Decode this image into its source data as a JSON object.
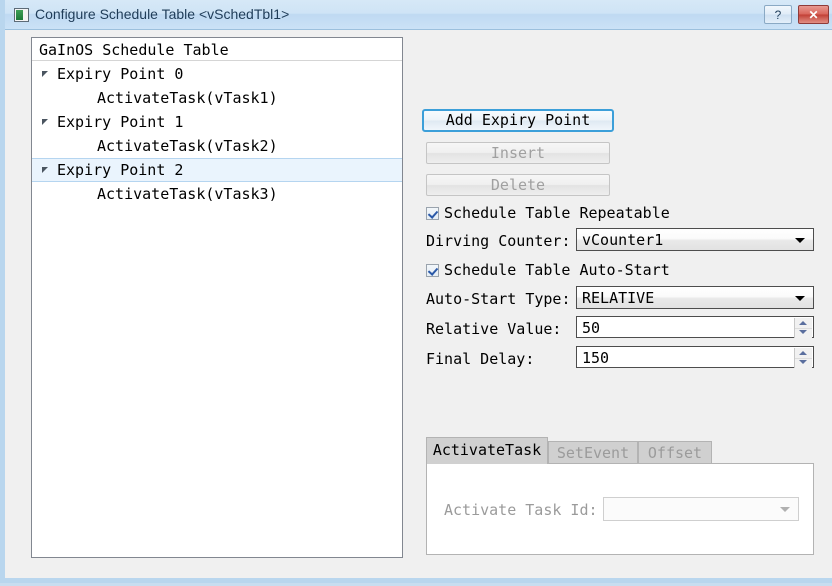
{
  "window": {
    "title": "Configure Schedule Table <vSchedTbl1>",
    "help_label": "?",
    "close_label": "✕"
  },
  "tree": {
    "header": "GaInOS Schedule Table",
    "nodes": [
      {
        "label": "Expiry Point 0",
        "type": "parent",
        "selected": false
      },
      {
        "label": "ActivateTask(vTask1)",
        "type": "child",
        "selected": false
      },
      {
        "label": "Expiry Point 1",
        "type": "parent",
        "selected": false
      },
      {
        "label": "ActivateTask(vTask2)",
        "type": "child",
        "selected": false
      },
      {
        "label": "Expiry Point 2",
        "type": "parent",
        "selected": true
      },
      {
        "label": "ActivateTask(vTask3)",
        "type": "child",
        "selected": false
      }
    ]
  },
  "buttons": {
    "add": "Add Expiry Point",
    "insert": "Insert",
    "delete": "Delete"
  },
  "form": {
    "repeatable_label": "Schedule Table Repeatable",
    "repeatable_checked": true,
    "driving_counter_label": "Dirving Counter:",
    "driving_counter_value": "vCounter1",
    "autostart_label": "Schedule Table Auto-Start",
    "autostart_checked": true,
    "autostart_type_label": "Auto-Start Type:",
    "autostart_type_value": "RELATIVE",
    "relative_value_label": "Relative Value:",
    "relative_value": "50",
    "final_delay_label": "Final Delay:",
    "final_delay": "150"
  },
  "tabs": {
    "items": [
      {
        "label": "ActivateTask",
        "active": true,
        "enabled": true
      },
      {
        "label": "SetEvent",
        "active": false,
        "enabled": false
      },
      {
        "label": "Offset",
        "active": false,
        "enabled": false
      }
    ],
    "page": {
      "activate_task_id_label": "Activate Task Id:",
      "activate_task_id_value": ""
    }
  },
  "colors": {
    "accent": "#3c9fd9",
    "selection": "#eaf4fd",
    "window_border": "#b9d6ee",
    "close_button": "#c24036"
  }
}
